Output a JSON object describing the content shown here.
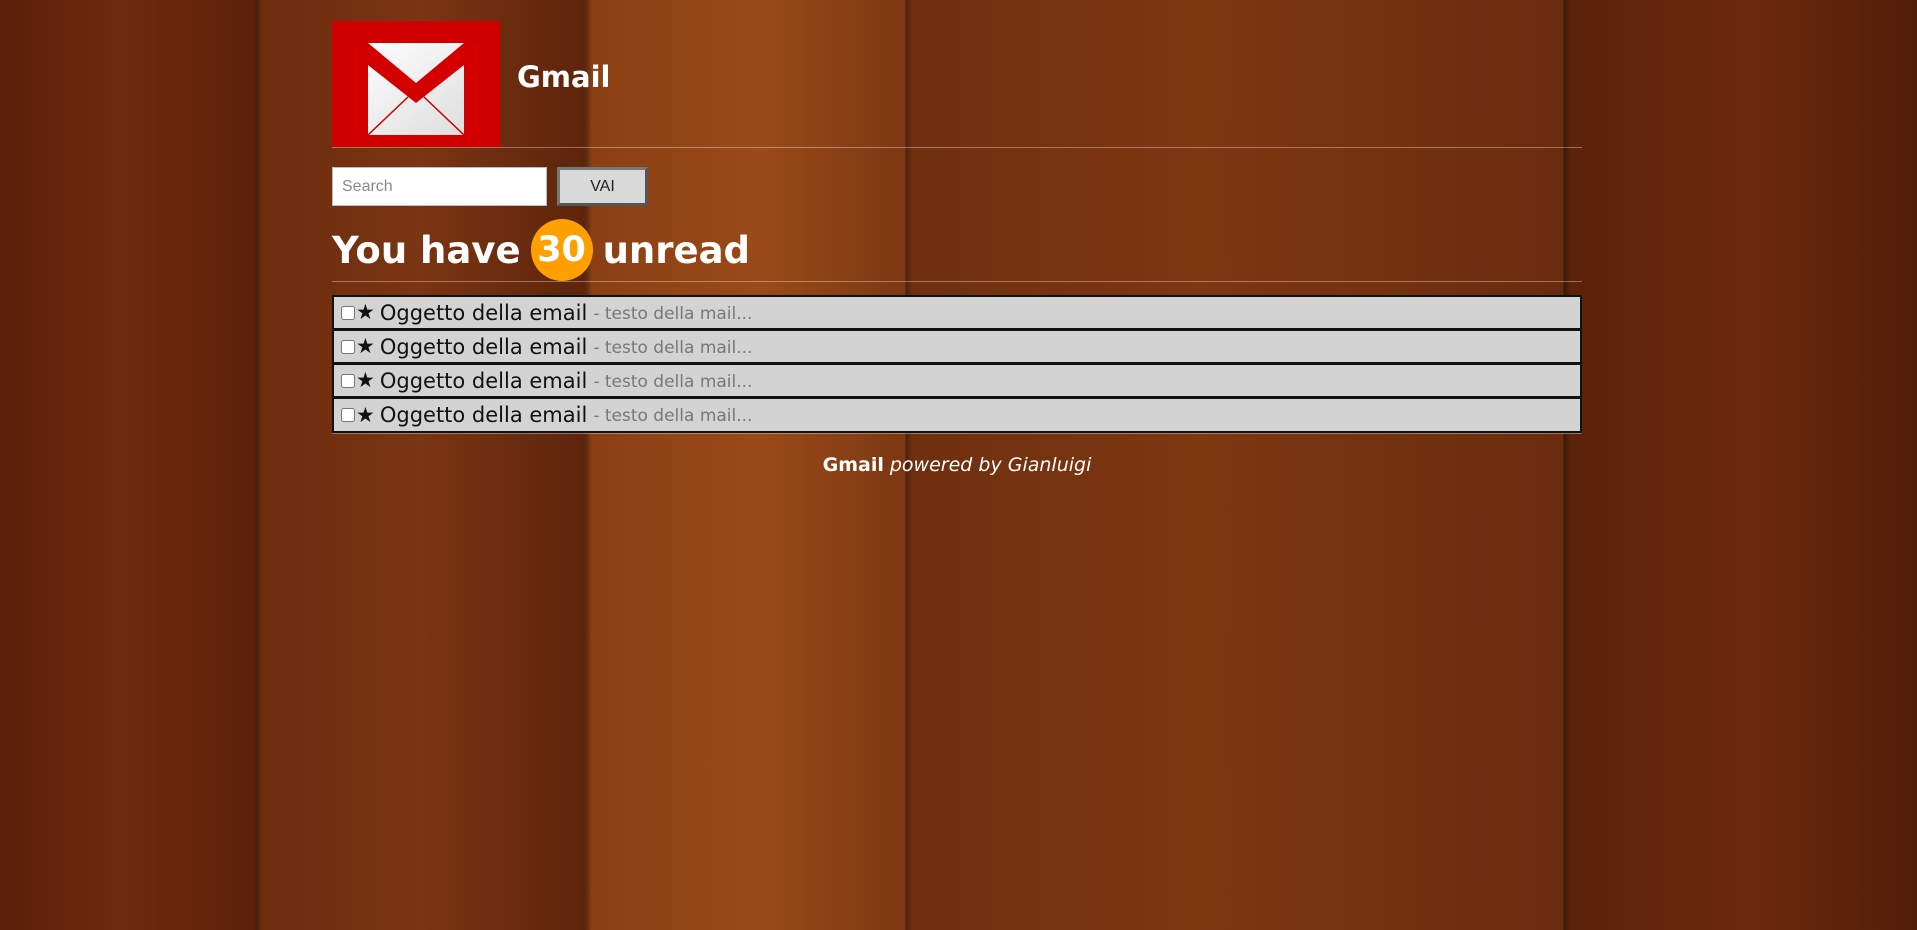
{
  "header": {
    "title": "Gmail",
    "logo_icon": "gmail-envelope-icon"
  },
  "search": {
    "placeholder": "Search",
    "value": "",
    "button_label": "VAI"
  },
  "unread": {
    "prefix": "You have",
    "count": "30",
    "suffix": "unread",
    "badge_color": "#ffa000"
  },
  "emails": [
    {
      "subject": "Oggetto della email",
      "preview": "- testo della mail...",
      "star": "★",
      "checked": false
    },
    {
      "subject": "Oggetto della email",
      "preview": "- testo della mail...",
      "star": "★",
      "checked": false
    },
    {
      "subject": "Oggetto della email",
      "preview": "- testo della mail...",
      "star": "★",
      "checked": false
    },
    {
      "subject": "Oggetto della email",
      "preview": "- testo della mail...",
      "star": "★",
      "checked": false
    }
  ],
  "footer": {
    "brand": "Gmail",
    "text": "powered by Gianluigi"
  }
}
